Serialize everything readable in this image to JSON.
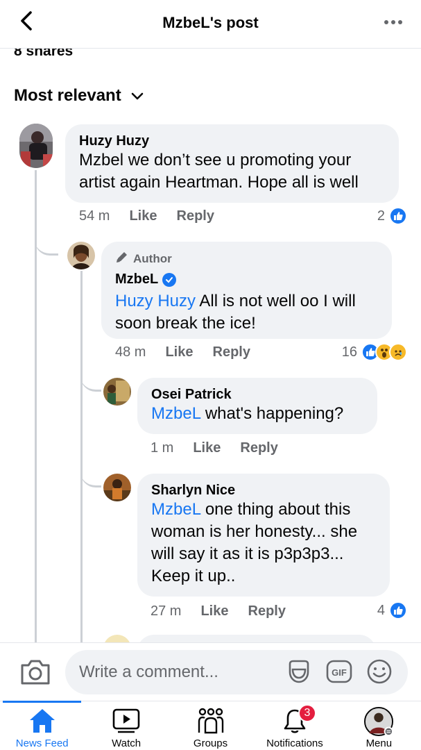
{
  "header": {
    "title": "MzbeL's post"
  },
  "post": {
    "shares_text": "8 shares",
    "sort_label": "Most relevant"
  },
  "comments": [
    {
      "author": "Huzy Huzy",
      "text": "Mzbel we don’t see u promoting your artist again Heartman. Hope all is well",
      "time": "54 m",
      "like_label": "Like",
      "reply_label": "Reply",
      "reaction_count": "2"
    },
    {
      "badge": "Author",
      "author": "MzbeL",
      "mention": "Huzy Huzy",
      "text": " All is not well oo I will soon break the ice!",
      "time": "48 m",
      "like_label": "Like",
      "reply_label": "Reply",
      "reaction_count": "16"
    },
    {
      "author": "Osei Patrick",
      "mention": "MzbeL",
      "text": " what's happening?",
      "time": "1 m",
      "like_label": "Like",
      "reply_label": "Reply"
    },
    {
      "author": "Sharlyn Nice",
      "mention": "MzbeL",
      "text": " one thing about this woman is her honesty... she will say it as it is p3p3p3... Keep it up..",
      "time": "27 m",
      "like_label": "Like",
      "reply_label": "Reply",
      "reaction_count": "4"
    }
  ],
  "composer": {
    "placeholder": "Write a comment..."
  },
  "tabbar": {
    "tabs": [
      {
        "label": "News Feed",
        "icon": "home-icon",
        "active": true
      },
      {
        "label": "Watch",
        "icon": "video-icon"
      },
      {
        "label": "Groups",
        "icon": "groups-icon"
      },
      {
        "label": "Notifications",
        "icon": "bell-icon",
        "badge": "3"
      },
      {
        "label": "Menu",
        "icon": "profile-avatar"
      }
    ]
  },
  "colors": {
    "accent": "#1877f2",
    "bubble": "#f0f2f5",
    "secondary_text": "#65676b",
    "badge": "#e41e3f"
  }
}
